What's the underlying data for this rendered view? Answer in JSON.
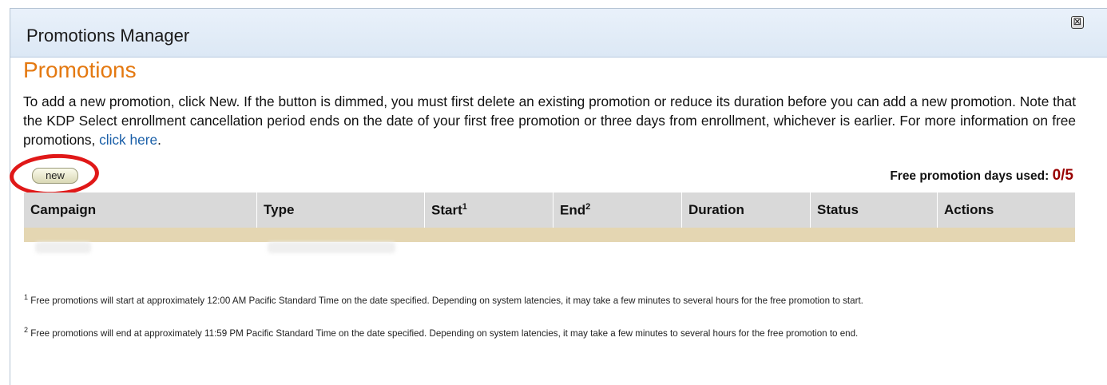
{
  "dialog": {
    "title": "Promotions Manager",
    "close_symbol": "⊠"
  },
  "main": {
    "heading": "Promotions",
    "intro_text": "To add a new promotion, click New. If the button is dimmed, you must first delete an existing promotion or reduce its duration before you can add a new promotion. Note that the KDP Select enrollment cancellation period ends on the date of your first free promotion or three days from enrollment, whichever is earlier. For more information on free promotions, ",
    "intro_link": "click here",
    "intro_end": "."
  },
  "toolbar": {
    "new_label": "new",
    "days_used_label": "Free promotion days used:",
    "days_used_value": "0/5"
  },
  "table": {
    "columns": [
      {
        "label": "Campaign",
        "sup": ""
      },
      {
        "label": "Type",
        "sup": ""
      },
      {
        "label": "Start",
        "sup": "1"
      },
      {
        "label": "End",
        "sup": "2"
      },
      {
        "label": "Duration",
        "sup": ""
      },
      {
        "label": "Status",
        "sup": ""
      },
      {
        "label": "Actions",
        "sup": ""
      }
    ]
  },
  "footnotes": [
    {
      "mark": "1",
      "text": "Free promotions will start at approximately 12:00 AM Pacific Standard Time on the date specified. Depending on system latencies, it may take a few minutes to several hours for the free promotion to start."
    },
    {
      "mark": "2",
      "text": "Free promotions will end at approximately 11:59 PM Pacific Standard Time on the date specified. Depending on system latencies, it may take a few minutes to several hours for the free promotion to end."
    }
  ],
  "colors": {
    "heading": "#e47911",
    "link": "#1a5fa8",
    "highlight": "#e01818",
    "count": "#990000",
    "table_bar": "#e4d6b2"
  }
}
